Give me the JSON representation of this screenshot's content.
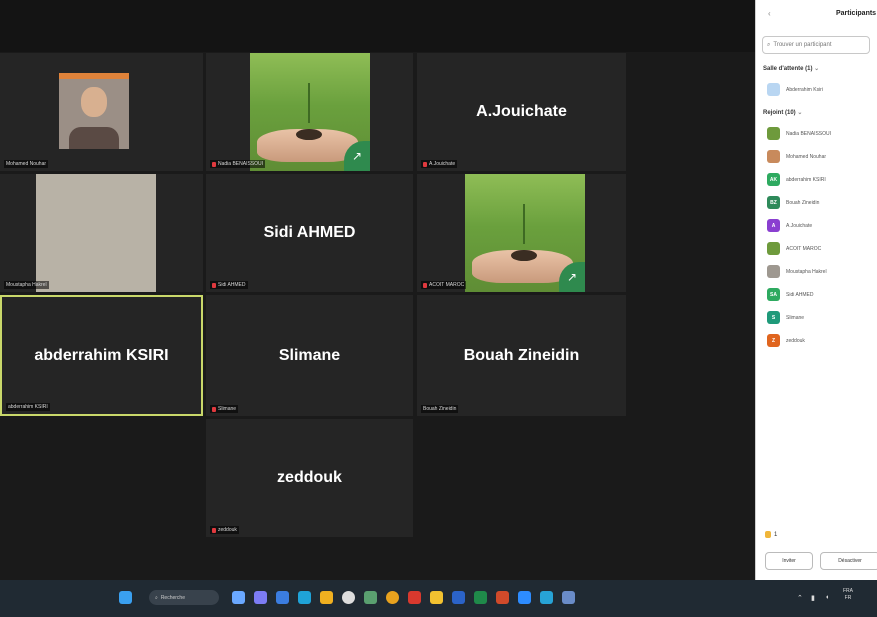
{
  "tiles": [
    {
      "name": "",
      "label": "Mohamed Nouhar"
    },
    {
      "name": "",
      "label": "Nadia BENAISSOUI"
    },
    {
      "name": "A.Jouichate",
      "label": "A.Jouichate"
    },
    {
      "name": "",
      "label": "Moustapha Hakrel"
    },
    {
      "name": "Sidi AHMED",
      "label": "Sidi AHMED"
    },
    {
      "name": "",
      "label": "ACOIT MAROC"
    },
    {
      "name": "abderrahim KSIRI",
      "label": "abderrahim KSIRI"
    },
    {
      "name": "Slimane",
      "label": "Slimane"
    },
    {
      "name": "Bouah Zineidin",
      "label": "Bouah Zineidin"
    },
    {
      "name": "zeddouk",
      "label": "zeddouk"
    }
  ],
  "panel": {
    "back": "‹",
    "title": "Participants",
    "search_placeholder": "Trouver un participant",
    "waiting_header": "Salle d'attente (1)",
    "waiting": [
      {
        "name": "Abderrahim Ksiri",
        "initials": "",
        "color": "#b9d6f2"
      }
    ],
    "joined_header": "Rejoint (10)",
    "joined": [
      {
        "name": "Nadia BENAISSOUI",
        "initials": "",
        "color": "#6e9a3c"
      },
      {
        "name": "Mohamed Nouhar",
        "initials": "",
        "color": "#c88a5c"
      },
      {
        "name": "abderrahim KSIRI",
        "initials": "AK",
        "color": "#2eaa60"
      },
      {
        "name": "Bouah Zineidin",
        "initials": "BZ",
        "color": "#2e8a5a"
      },
      {
        "name": "A.Jouichate",
        "initials": "A",
        "color": "#8a3fd0"
      },
      {
        "name": "ACOIT MAROC",
        "initials": "",
        "color": "#6e9a3c"
      },
      {
        "name": "Moustapha Hakrel",
        "initials": "",
        "color": "#9e9890"
      },
      {
        "name": "Sidi AHMED",
        "initials": "SA",
        "color": "#2eaa60"
      },
      {
        "name": "Slimane",
        "initials": "S",
        "color": "#1f9a7a"
      },
      {
        "name": "zeddouk",
        "initials": "Z",
        "color": "#e0651e"
      }
    ],
    "raised_hands": "1",
    "invite_label": "Inviter",
    "unmute_label": "Désactiver"
  },
  "taskbar": {
    "search_text": "Recherche",
    "clock_time": "FRA",
    "clock_date": "FR"
  },
  "colors": {
    "active_speaker": "#c9d86a",
    "mic_off": "#e0393e"
  }
}
